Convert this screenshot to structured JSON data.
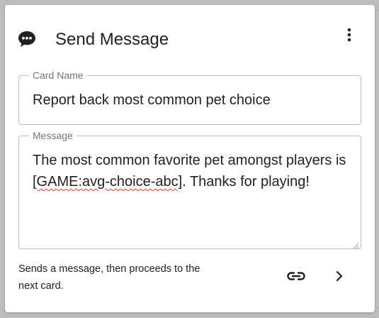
{
  "card": {
    "title": "Send Message",
    "header_icon": "chat-bubble-icon",
    "menu_icon": "more-vert-icon"
  },
  "fields": {
    "card_name": {
      "label": "Card Name",
      "value": "Report back most common pet choice"
    },
    "message": {
      "label": "Message",
      "value_before": "The most common favorite pet amongst players is ",
      "value_flagged": "[GAME:avg-choice-abc]",
      "value_after": ". Thanks for playing!"
    }
  },
  "footer": {
    "description": "Sends a message, then proceeds to the next card.",
    "link_icon": "link-icon",
    "next_icon": "chevron-right-icon"
  },
  "colors": {
    "background": "#bdbdbd",
    "card": "#ffffff",
    "text": "#212121",
    "label": "#757575",
    "border": "#bdbdbd",
    "spellcheck": "#e53935"
  }
}
